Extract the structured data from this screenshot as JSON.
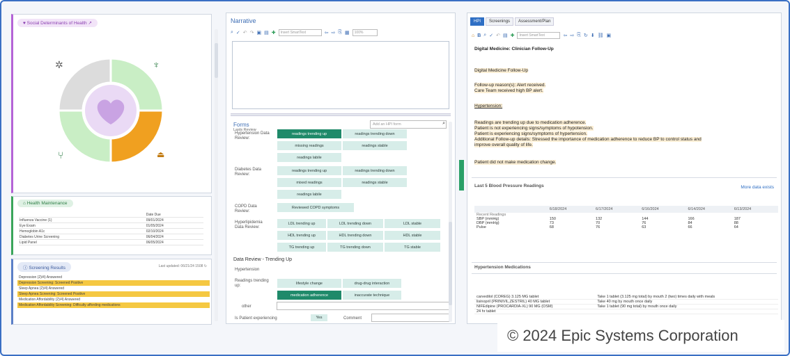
{
  "sdoh": {
    "title": "Social Determinants of Health"
  },
  "health_maintenance": {
    "title": "Health Maintenance",
    "col_header": "Date Due",
    "rows": [
      {
        "name": "Influenza Vaccine (1)",
        "due": "09/01/2024"
      },
      {
        "name": "Eye Exam",
        "due": "01/05/2024"
      },
      {
        "name": "Hemoglobin A1c",
        "due": "02/10/2024"
      },
      {
        "name": "Diabetes Urine Screening",
        "due": "06/04/2024"
      },
      {
        "name": "Lipid Panel",
        "due": "06/05/2024"
      }
    ]
  },
  "screening": {
    "title": "Screening Results",
    "updated": "Last updated: 06/21/24 1508",
    "rows": [
      {
        "label": "Depression (2)/4) Answered",
        "hl": false
      },
      {
        "label": "Depression Screening: Screened Positive",
        "hl": true
      },
      {
        "label": "Sleep Apnea (2)/4) Answered",
        "hl": false
      },
      {
        "label": "Sleep Apnea Screening: Screened Positive",
        "hl": true
      },
      {
        "label": "Medication Affordability (2)/4) Answered",
        "hl": false
      },
      {
        "label": "Medication Affordability Screening: Difficulty affording medications",
        "hl": true
      }
    ]
  },
  "narrative": {
    "title": "Narrative",
    "smarttext_placeholder": "Insert SmartText",
    "zoom": "100%"
  },
  "forms": {
    "title": "Forms",
    "last_review": "Lasts Review",
    "add_placeholder": "Add an HPI form",
    "hypertension_label": "Hypertension Data Review:",
    "diabetes_label": "Diabetes Data Review:",
    "copd_label": "COPD Data Review:",
    "hyperlipidemia_label": "Hyperlipidemia Data Review:",
    "b_read_up": "readings trending up",
    "b_read_down": "readings trending down",
    "b_missing": "missing readings",
    "b_stable": "readings stable",
    "b_labile": "readings labile",
    "b_mixed": "mixed readings",
    "b_copd": "Reviewed COPD symptoms",
    "b_ldl_up": "LDL trending up",
    "b_ldl_down": "LDL trending down",
    "b_ldl_stable": "LDL stable",
    "b_hdl_up": "HDL trending up",
    "b_hdl_down": "HDL trending down",
    "b_hdl_stable": "HDL stable",
    "b_tg_up": "TG trending up",
    "b_tg_down": "TG trending down",
    "b_tg_stable": "TG stable",
    "trend_title": "Data Review - Trending Up",
    "trend_sub": "Hypertension",
    "readings_label": "Readings trending up:",
    "b_lifestyle": "lifestyle change",
    "b_drug": "drug-drug interaction",
    "b_adherence": "medication adherence",
    "b_technique": "inaccurate technique",
    "other_label": "other",
    "symptoms_label": "Is Patient experiencing",
    "yes_label": "Yes",
    "comment_label": "Comment"
  },
  "right": {
    "tabs": [
      "HPI",
      "Screenings",
      "Assessment/Plan"
    ],
    "smarttext_placeholder": "Insert SmartText",
    "note_title": "Digital Medicine: Clinician Follow-Up",
    "followup_title": "Digital Medicine Follow-Up",
    "reason1": "Follow-up reason(s): Alert received.",
    "reason2": "Care Team received high BP alert.",
    "htn": "Hypertension:",
    "p1": "Readings are trending up due to medication adherence.",
    "p2": "Patient is not experiencing signs/symptoms of hypotension.",
    "p3": "Patient is experiencing signs/symptoms of hypertension.",
    "p4": "Additional Follow-up details: Stressed the importance of medication adherence to reduce BP to control status and",
    "p5": "improve overall quality of life.",
    "med_change": "Patient did not make medication change.",
    "bp_title": "Last 5 Blood Pressure Readings",
    "more_data": "More data exists",
    "bp_dates": [
      "6/18/2024",
      "6/17/2024",
      "6/16/2024",
      "6/14/2024",
      "6/13/2024"
    ],
    "recent_label": "Recent Readings",
    "bp_rows": [
      {
        "label": "SBP (mmHg)",
        "values": [
          "150",
          "132",
          "144",
          "166",
          "187"
        ]
      },
      {
        "label": "DBP (mmHg)",
        "values": [
          "73",
          "70",
          "76",
          "84",
          "88"
        ]
      },
      {
        "label": "Pulse",
        "values": [
          "68",
          "76",
          "63",
          "66",
          "64"
        ]
      }
    ],
    "meds_title": "Hypertension Medications",
    "meds": [
      {
        "name": "carvedilol (COREG) 3.125 MG tablet",
        "sig": "Take 1 tablet (3.125 mg total) by mouth 2 (two) times daily with meals"
      },
      {
        "name": "lisinopril (PRINIVIL,ZESTRIL) 40 MG tablet",
        "sig": "Take 40 mg by mouth once daily"
      },
      {
        "name": "NIFEdipine (PROCARDIA-XL) 90 MG (OSM)",
        "sig": "Take 1 tablet (90 mg total) by mouth once daily"
      },
      {
        "name": "24 hr tablet",
        "sig": ""
      }
    ]
  },
  "copyright": "© 2024 Epic Systems Corporation",
  "colors": {
    "accent": "#2f6fc4",
    "selected": "#1f8a6a",
    "button": "#d7ede9",
    "sdoh_orange": "#f0a020",
    "sdoh_green": "#c9eec5",
    "highlight": "#f5c842"
  }
}
